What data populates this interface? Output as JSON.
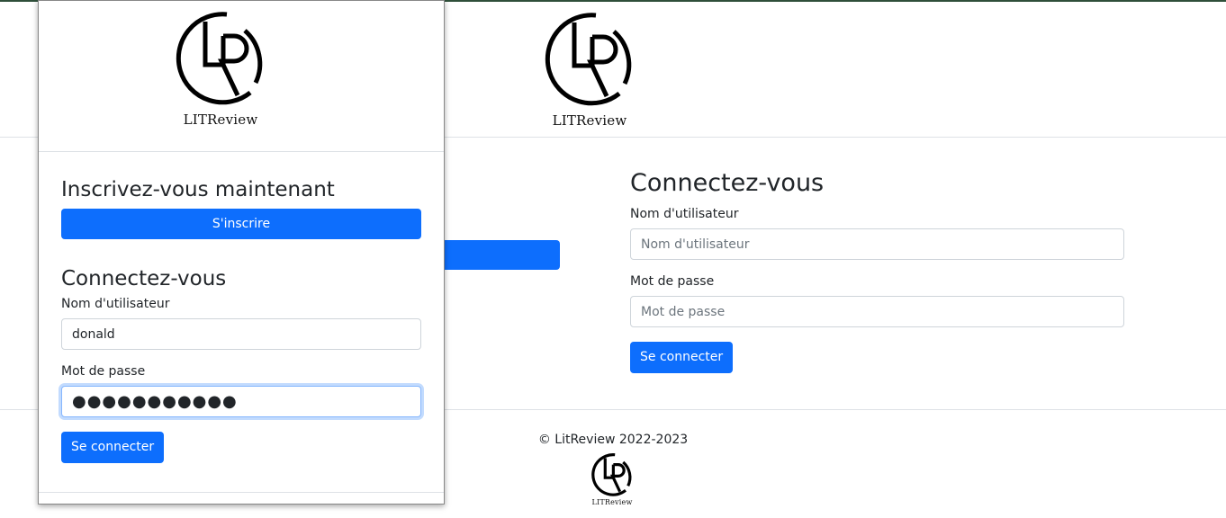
{
  "brand": {
    "logo_text": "LITReview"
  },
  "background_page": {
    "login": {
      "title": "Connectez-vous",
      "username_label": "Nom d'utilisateur",
      "username_placeholder": "Nom d'utilisateur",
      "password_label": "Mot de passe",
      "password_placeholder": "Mot de passe",
      "submit_label": "Se connecter"
    },
    "footer": {
      "copyright": "© LitReview 2022-2023"
    }
  },
  "mobile_panel": {
    "signup": {
      "title": "Inscrivez-vous maintenant",
      "button_label": "S'inscrire"
    },
    "login": {
      "title": "Connectez-vous",
      "username_label": "Nom d'utilisateur",
      "username_value": "donald",
      "password_label": "Mot de passe",
      "password_value": "●●●●●●●●●●●",
      "submit_label": "Se connecter"
    }
  },
  "colors": {
    "primary": "#0d6efd",
    "border": "#dee2e6",
    "focus": "#86b7fe"
  }
}
